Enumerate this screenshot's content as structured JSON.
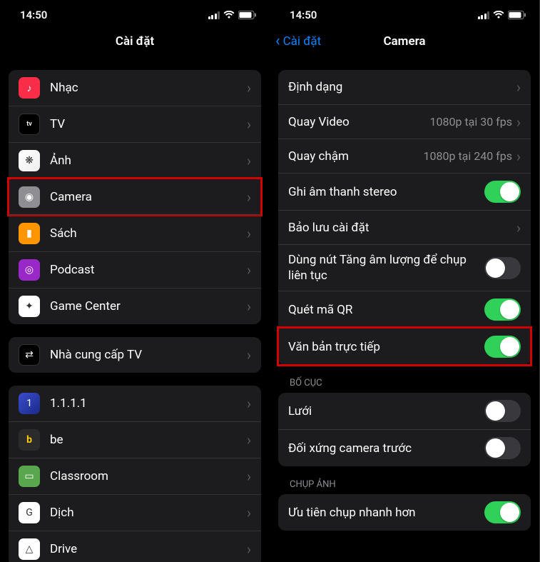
{
  "status": {
    "time": "14:50"
  },
  "left": {
    "title": "Cài đặt",
    "groups": [
      {
        "items": [
          {
            "iconClass": "ic-music",
            "iconGlyph": "♪",
            "label": "Nhạc",
            "kind": "disclosure",
            "name": "row-music",
            "iconName": "music-icon"
          },
          {
            "iconClass": "ic-tv",
            "iconGlyph": "tv",
            "label": "TV",
            "kind": "disclosure",
            "name": "row-tv",
            "iconName": "tv-icon"
          },
          {
            "iconClass": "ic-photos",
            "iconGlyph": "❋",
            "label": "Ảnh",
            "kind": "disclosure",
            "name": "row-photos",
            "iconName": "photos-icon"
          },
          {
            "iconClass": "ic-camera",
            "iconGlyph": "◉",
            "label": "Camera",
            "kind": "disclosure",
            "highlight": true,
            "name": "row-camera",
            "iconName": "camera-icon"
          },
          {
            "iconClass": "ic-books",
            "iconGlyph": "▮",
            "label": "Sách",
            "kind": "disclosure",
            "name": "row-books",
            "iconName": "books-icon"
          },
          {
            "iconClass": "ic-podcast",
            "iconGlyph": "◎",
            "label": "Podcast",
            "kind": "disclosure",
            "name": "row-podcast",
            "iconName": "podcast-icon"
          },
          {
            "iconClass": "ic-gc",
            "iconGlyph": "✦",
            "label": "Game Center",
            "kind": "disclosure",
            "name": "row-gamecenter",
            "iconName": "gamecenter-icon"
          }
        ]
      },
      {
        "items": [
          {
            "iconClass": "ic-tvprov",
            "iconGlyph": "⇄",
            "label": "Nhà cung cấp TV",
            "kind": "disclosure",
            "name": "row-tvprovider",
            "iconName": "tvprovider-icon"
          }
        ]
      },
      {
        "items": [
          {
            "iconClass": "ic-1111",
            "iconGlyph": "1",
            "label": "1.1.1.1",
            "kind": "disclosure",
            "name": "row-1111",
            "iconName": "app-1111-icon"
          },
          {
            "iconClass": "ic-be",
            "iconGlyph": "b",
            "label": "be",
            "kind": "disclosure",
            "name": "row-be",
            "iconName": "app-be-icon"
          },
          {
            "iconClass": "ic-class",
            "iconGlyph": "▭",
            "label": "Classroom",
            "kind": "disclosure",
            "name": "row-classroom",
            "iconName": "app-classroom-icon"
          },
          {
            "iconClass": "ic-dich",
            "iconGlyph": "G",
            "label": "Dịch",
            "kind": "disclosure",
            "name": "row-translate",
            "iconName": "app-translate-icon"
          },
          {
            "iconClass": "ic-drive",
            "iconGlyph": "△",
            "label": "Drive",
            "kind": "disclosure",
            "name": "row-drive",
            "iconName": "app-drive-icon"
          }
        ]
      }
    ]
  },
  "right": {
    "back": "Cài đặt",
    "title": "Camera",
    "groups": [
      {
        "items": [
          {
            "label": "Định dạng",
            "kind": "disclosure",
            "name": "row-formats"
          },
          {
            "label": "Quay Video",
            "detail": "1080p tại 30 fps",
            "kind": "disclosure",
            "name": "row-record-video"
          },
          {
            "label": "Quay chậm",
            "detail": "1080p tại 240 fps",
            "kind": "disclosure",
            "name": "row-record-slomo"
          },
          {
            "label": "Ghi âm thanh stereo",
            "kind": "toggle",
            "on": true,
            "name": "row-stereo"
          },
          {
            "label": "Bảo lưu cài đặt",
            "kind": "disclosure",
            "name": "row-preserve"
          },
          {
            "label": "Dùng nút Tăng âm lượng để chụp liên tục",
            "kind": "toggle",
            "on": false,
            "wrap": true,
            "name": "row-volume-burst"
          },
          {
            "label": "Quét mã QR",
            "kind": "toggle",
            "on": true,
            "name": "row-qr"
          },
          {
            "label": "Văn bản trực tiếp",
            "kind": "toggle",
            "on": true,
            "highlight": true,
            "name": "row-live-text"
          }
        ]
      },
      {
        "header": "BỐ CỤC",
        "items": [
          {
            "label": "Lưới",
            "kind": "toggle",
            "on": false,
            "name": "row-grid"
          },
          {
            "label": "Đối xứng camera trước",
            "kind": "toggle",
            "on": false,
            "name": "row-mirror-front"
          }
        ]
      },
      {
        "header": "CHỤP ẢNH",
        "items": [
          {
            "label": "Ưu tiên chụp nhanh hơn",
            "kind": "toggle",
            "on": true,
            "name": "row-faster-capture"
          }
        ]
      }
    ]
  }
}
